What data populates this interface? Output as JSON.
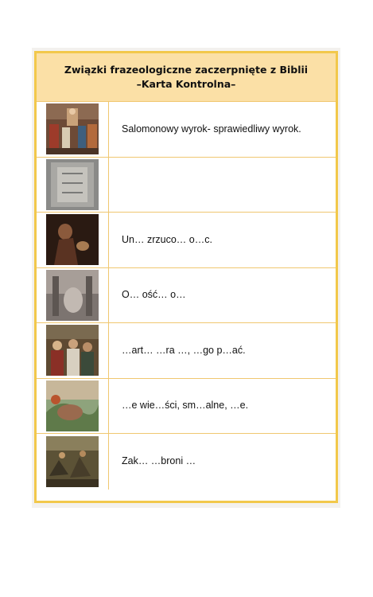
{
  "card": {
    "title_line1": "Związki frazeologiczne zaczerpnięte z Biblii",
    "title_line2": "–Karta Kontrolna–"
  },
  "rows": [
    {
      "text": "Salomonowy wyrok-  sprawiedliwy wyrok.",
      "image": "judgement-painting"
    },
    {
      "text": "",
      "image": "stone-relief"
    },
    {
      "text": "Un… zrzuco… o…c.",
      "image": "dark-figure-painting"
    },
    {
      "text": "O… ość… o…",
      "image": "misty-interior-painting"
    },
    {
      "text": "…art… …ra …, …go p…ać.",
      "image": "crowd-scene-painting"
    },
    {
      "text": "…e wie…ści, sm…alne, …e.",
      "image": "landscape-painting"
    },
    {
      "text": "Zak… …broni …",
      "image": "battle-painting"
    }
  ]
}
